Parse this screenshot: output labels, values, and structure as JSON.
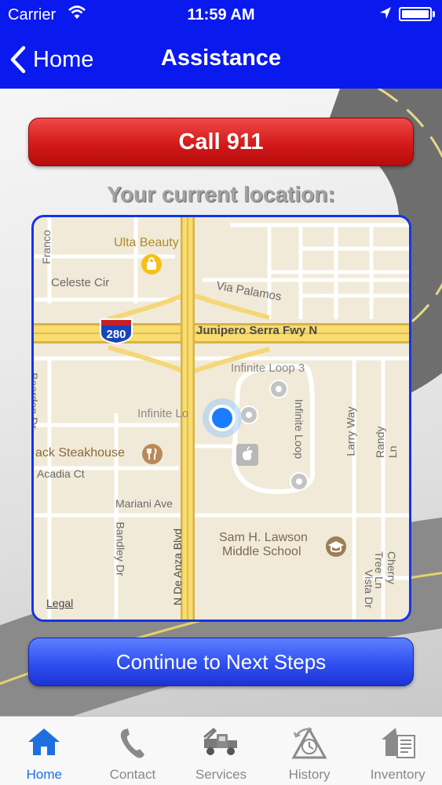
{
  "status_bar": {
    "carrier": "Carrier",
    "time": "11:59 AM"
  },
  "nav": {
    "back_label": "Home",
    "title": "Assistance"
  },
  "actions": {
    "call_label": "Call 911",
    "continue_label": "Continue to Next Steps"
  },
  "location": {
    "heading": "Your current location:",
    "map": {
      "highway_shield": "280",
      "labels": {
        "franco": "Franco",
        "ulta": "Ulta Beauty",
        "celeste": "Celeste Cir",
        "via_palamos": "Via Palamos",
        "junipero": "Junipero Serra Fwy N",
        "infinite_loop_3": "Infinite Loop 3",
        "infinite_loop": "Infinite Loop",
        "infinite_lo": "Infinite Lo",
        "beardon": "Beardon Dr",
        "larry": "Larry Way",
        "randy": "Randy Ln",
        "steakhouse": "ack Steakhouse",
        "acadia": "Acadia Ct",
        "mariani": "Mariani Ave",
        "bandley": "Bandley Dr",
        "de_anza": "N De Anza Blvd",
        "lawson_1": "Sam H. Lawson",
        "lawson_2": "Middle School",
        "vista": "Vista Dr",
        "cherry": "Cherry Tree Ln",
        "legal": "Legal"
      }
    }
  },
  "tabs": [
    {
      "label": "Home",
      "icon": "home-icon",
      "active": true
    },
    {
      "label": "Contact",
      "icon": "phone-icon",
      "active": false
    },
    {
      "label": "Services",
      "icon": "tow-truck-icon",
      "active": false
    },
    {
      "label": "History",
      "icon": "history-icon",
      "active": false
    },
    {
      "label": "Inventory",
      "icon": "inventory-icon",
      "active": false
    }
  ],
  "colors": {
    "header": "#0a1aee",
    "call": "#d41919",
    "continue": "#2f4ff0",
    "tab_active": "#1d6fe0",
    "map_border": "#1434e6"
  }
}
